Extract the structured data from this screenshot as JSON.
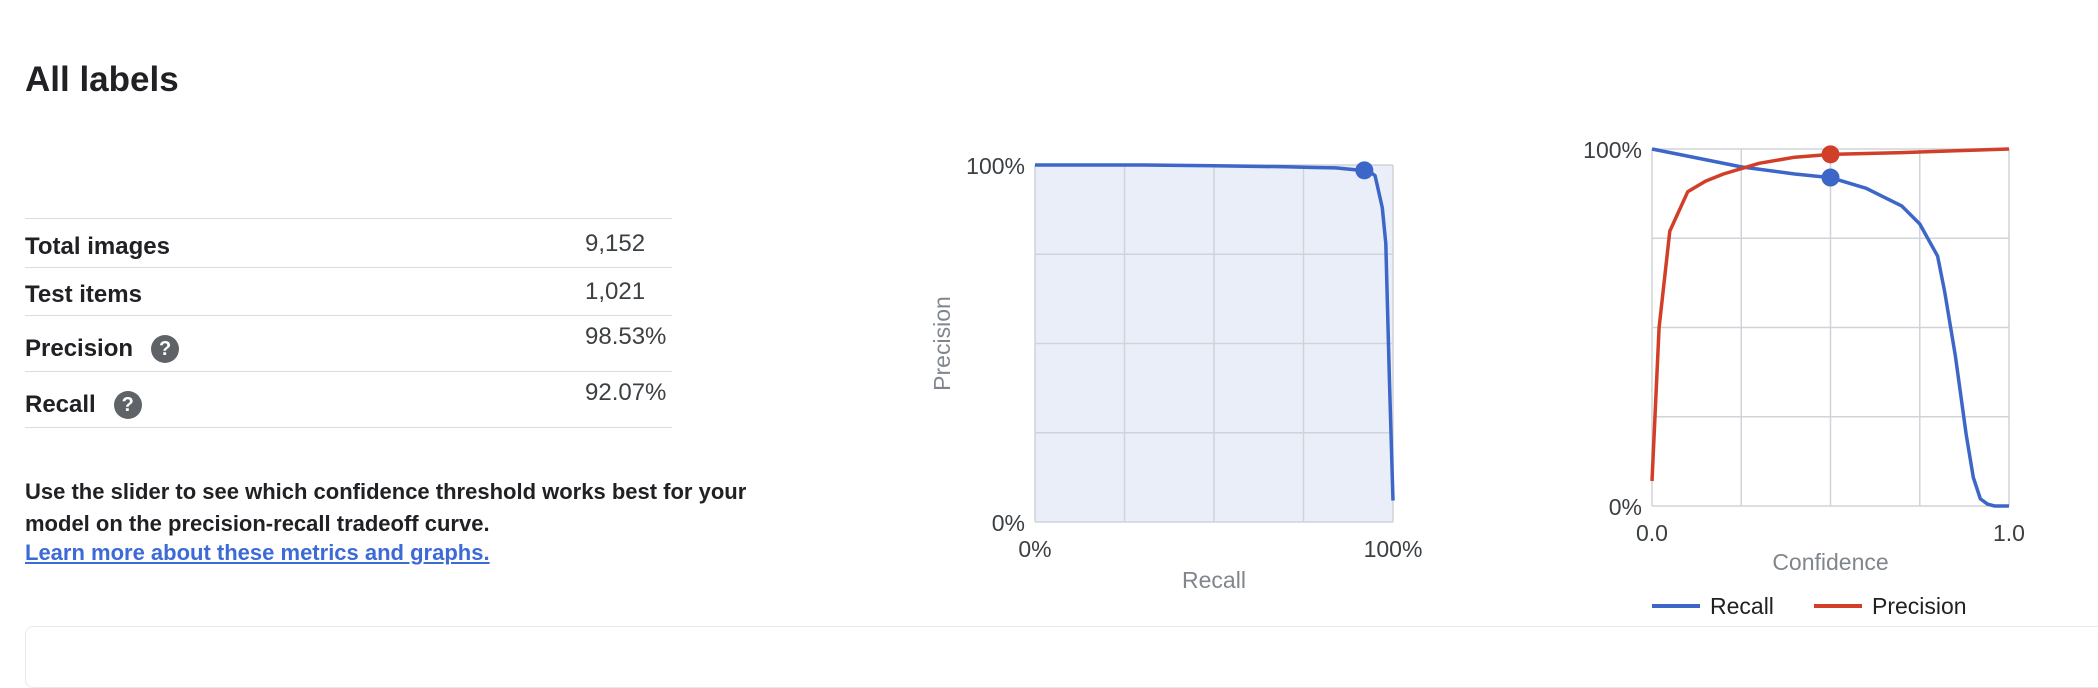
{
  "page": {
    "title": "All labels"
  },
  "stats": {
    "rows": [
      {
        "label": "Total images",
        "value": "9,152",
        "help": false
      },
      {
        "label": "Test items",
        "value": "1,021",
        "help": false
      },
      {
        "label": "Precision",
        "value": "98.53%",
        "help": true
      },
      {
        "label": "Recall",
        "value": "92.07%",
        "help": true
      }
    ],
    "help_glyph": "?"
  },
  "description": {
    "text": "Use the slider to see which confidence threshold works best for your model on the precision-recall tradeoff curve.",
    "link": "Learn more about these metrics and graphs."
  },
  "chart_data": [
    {
      "type": "line",
      "xlabel": "Recall",
      "ylabel": "Precision",
      "xlim": [
        0,
        1
      ],
      "ylim": [
        0,
        1
      ],
      "x_ticks": [
        "0%",
        "100%"
      ],
      "y_ticks": [
        "0%",
        "100%"
      ],
      "grid": true,
      "series": [
        {
          "color": "#3c66c8",
          "x": [
            0.0,
            0.3,
            0.5,
            0.7,
            0.78,
            0.84,
            0.88,
            0.91,
            0.93,
            0.95,
            0.97,
            0.98,
            0.99,
            1.0
          ],
          "y": [
            1.0,
            1.0,
            0.998,
            0.995,
            0.993,
            0.992,
            0.988,
            0.985,
            0.985,
            0.97,
            0.88,
            0.78,
            0.4,
            0.06
          ]
        }
      ],
      "marker": {
        "x": 0.92,
        "y": 0.985,
        "color": "#3c66c8"
      },
      "plot_background": "#eaeef8"
    },
    {
      "type": "line",
      "xlabel": "Confidence",
      "ylabel": "",
      "xlim": [
        0,
        1
      ],
      "ylim": [
        0,
        1
      ],
      "x_ticks": [
        "0.0",
        "1.0"
      ],
      "y_ticks": [
        "0%",
        "100%"
      ],
      "grid": true,
      "legend": "bottom",
      "series": [
        {
          "name": "Recall",
          "color": "#3c66c8",
          "x": [
            0.0,
            0.1,
            0.25,
            0.4,
            0.5,
            0.6,
            0.7,
            0.75,
            0.8,
            0.82,
            0.85,
            0.88,
            0.9,
            0.92,
            0.94,
            0.96,
            1.0
          ],
          "y": [
            1.0,
            0.98,
            0.95,
            0.93,
            0.92,
            0.89,
            0.84,
            0.79,
            0.7,
            0.6,
            0.42,
            0.2,
            0.08,
            0.02,
            0.005,
            0.0,
            0.0
          ]
        },
        {
          "name": "Precision",
          "color": "#d23f28",
          "x": [
            0.0,
            0.02,
            0.05,
            0.1,
            0.15,
            0.2,
            0.3,
            0.4,
            0.5,
            0.7,
            0.85,
            1.0
          ],
          "y": [
            0.07,
            0.5,
            0.77,
            0.88,
            0.91,
            0.93,
            0.96,
            0.977,
            0.985,
            0.99,
            0.995,
            1.0
          ]
        }
      ],
      "markers": [
        {
          "x": 0.5,
          "y": 0.985,
          "color": "#d23f28"
        },
        {
          "x": 0.5,
          "y": 0.92,
          "color": "#3c66c8"
        }
      ]
    }
  ]
}
